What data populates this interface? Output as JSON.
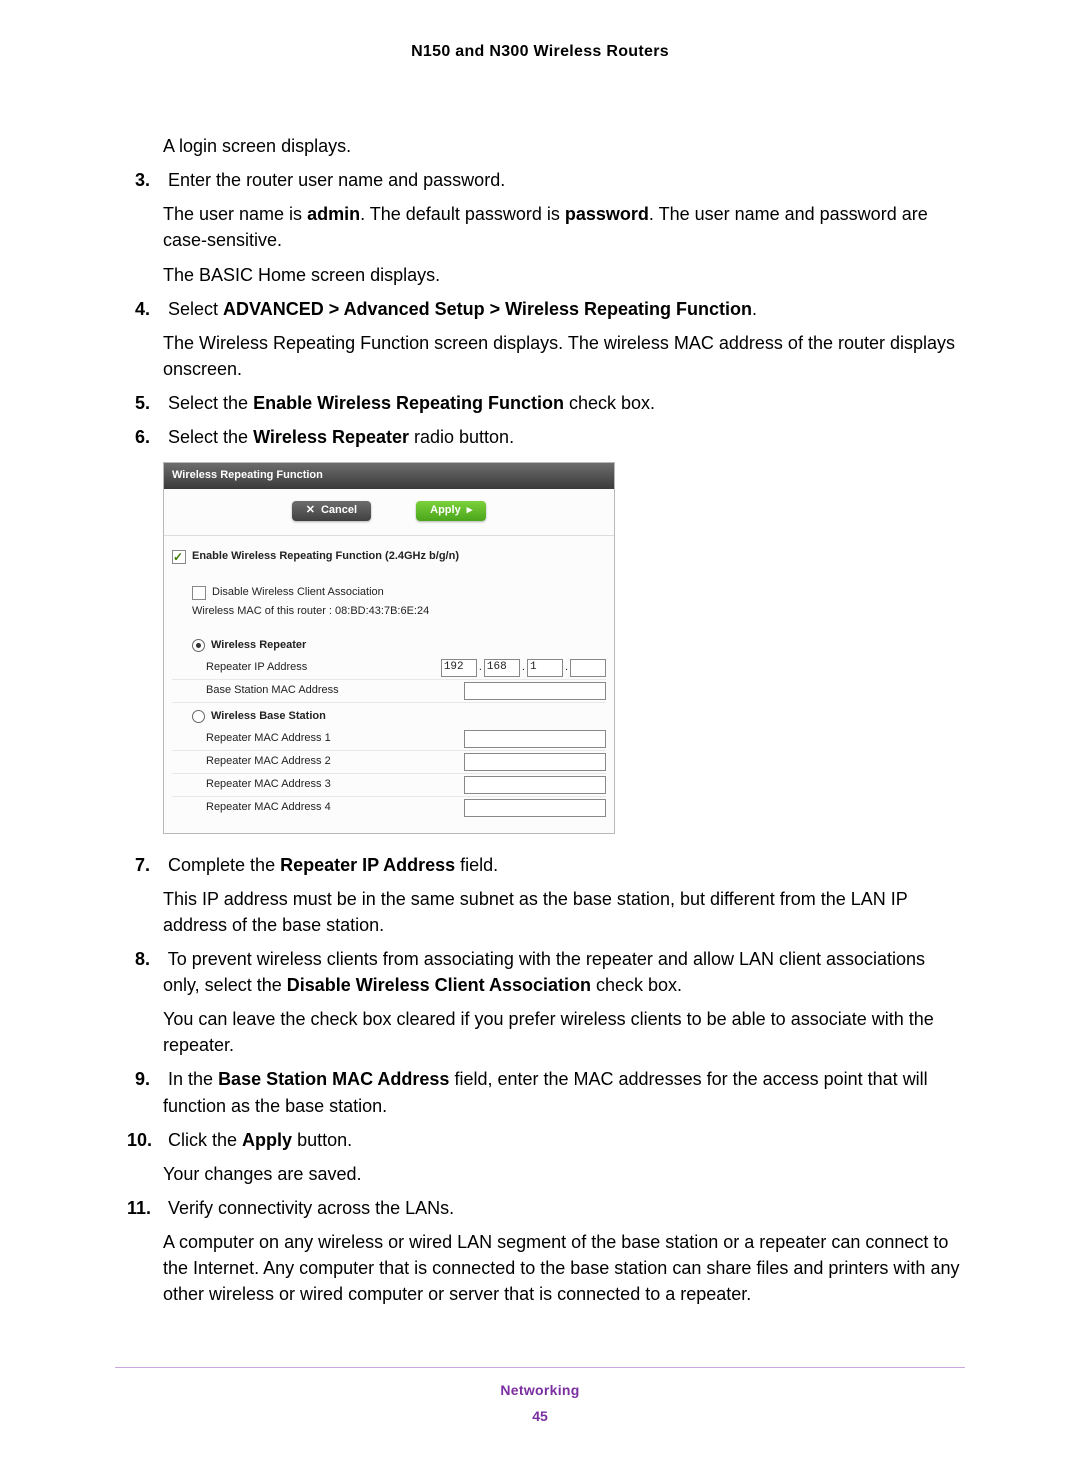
{
  "header": {
    "title": "N150 and N300 Wireless Routers"
  },
  "intro": {
    "login": "A login screen displays."
  },
  "step3": {
    "num": "3.",
    "text": "Enter the router user name and password.",
    "p1a": "The user name is ",
    "p1_admin": "admin",
    "p1b": ". The default password is ",
    "p1_pw": "password",
    "p1c": ". The user name and password are case-sensitive.",
    "p2": "The BASIC Home screen displays."
  },
  "step4": {
    "num": "4.",
    "text_a": "Select ",
    "text_b": "ADVANCED > Advanced Setup > Wireless Repeating Function",
    "text_c": ".",
    "p1": "The Wireless Repeating Function screen displays. The wireless MAC address of the router displays onscreen."
  },
  "step5": {
    "num": "5.",
    "a": "Select the ",
    "b": "Enable Wireless Repeating Function",
    "c": " check box."
  },
  "step6": {
    "num": "6.",
    "a": "Select the ",
    "b": "Wireless Repeater",
    "c": " radio button."
  },
  "ui": {
    "title": "Wireless Repeating Function",
    "cancel": "Cancel",
    "apply": "Apply",
    "enable": "Enable Wireless Repeating Function (2.4GHz b/g/n)",
    "disable_assoc": "Disable Wireless Client Association",
    "mac_label": "Wireless MAC of this router : 08:BD:43:7B:6E:24",
    "repeater": "Wireless Repeater",
    "rep_ip": "Repeater IP Address",
    "ip": {
      "o1": "192",
      "o2": "168",
      "o3": "1",
      "o4": ""
    },
    "base_mac": "Base Station MAC Address",
    "base_station": "Wireless Base Station",
    "rmac1": "Repeater MAC Address 1",
    "rmac2": "Repeater MAC Address 2",
    "rmac3": "Repeater MAC Address 3",
    "rmac4": "Repeater MAC Address 4"
  },
  "step7": {
    "num": "7.",
    "a": "Complete the ",
    "b": "Repeater IP Address",
    "c": " field.",
    "p1": "This IP address must be in the same subnet as the base station, but different from the LAN IP address of the base station."
  },
  "step8": {
    "num": "8.",
    "a": "To prevent wireless clients from associating with the repeater and allow LAN client associations only, select the ",
    "b": "Disable Wireless Client Association",
    "c": " check box.",
    "p1": "You can leave the check box cleared if you prefer wireless clients to be able to associate with the repeater."
  },
  "step9": {
    "num": "9.",
    "a": "In the ",
    "b": "Base Station MAC Address",
    "c": " field, enter the MAC addresses for the access point that will function as the base station."
  },
  "step10": {
    "num": "10.",
    "a": "Click the ",
    "b": "Apply",
    "c": " button.",
    "p1": "Your changes are saved."
  },
  "step11": {
    "num": "11.",
    "text": "Verify connectivity across the LANs.",
    "p1": "A computer on any wireless or wired LAN segment of the base station or a repeater can connect to the Internet. Any computer that is connected to the base station can share files and printers with any other wireless or wired computer or server that is connected to a repeater."
  },
  "footer": {
    "section": "Networking",
    "page": "45"
  }
}
